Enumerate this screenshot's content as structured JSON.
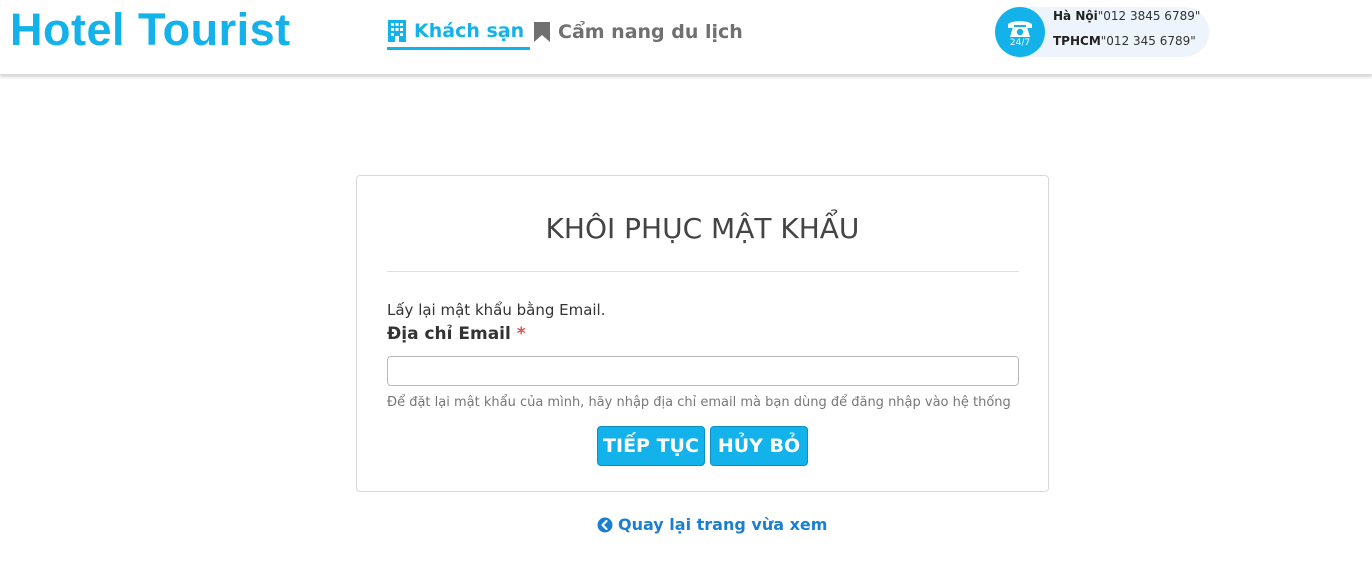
{
  "brand": "Hotel Tourist",
  "nav": {
    "hotels_label": "Khách sạn",
    "guide_label": "Cẩm nang du lịch"
  },
  "contact": {
    "badge": "24/7",
    "hanoi_label": "Hà Nội",
    "hanoi_phone": "\"012 3845 6789\"",
    "hcm_label": "TPHCM",
    "hcm_phone": "\"012 345 6789\""
  },
  "form": {
    "title": "KHÔI PHỤC MẬT KHẨU",
    "intro": "Lấy lại mật khẩu bằng Email.",
    "email_label": "Địa chỉ Email",
    "required_mark": "*",
    "email_value": "",
    "email_placeholder": "",
    "help_text": "Để đặt lại mật khẩu của mình, hãy nhập địa chỉ email mà bạn dùng để đăng nhập vào hệ thống",
    "continue_label": "TIẾP TỤC",
    "cancel_label": "HỦY BỎ"
  },
  "back_link": "Quay lại trang vừa xem",
  "colors": {
    "accent": "#14b2ea",
    "link": "#1a7fd3",
    "muted_nav": "#707070",
    "required": "#d9534f"
  },
  "icons": {
    "hotels": "building-icon",
    "guide": "bookmark-icon",
    "phone": "phone-icon",
    "back": "arrow-circle-left-icon"
  }
}
